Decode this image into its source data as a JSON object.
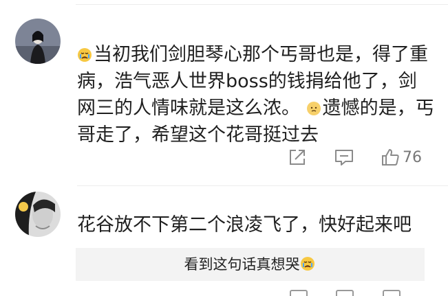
{
  "comments": [
    {
      "avatar_icon": "avatar-girl-photo",
      "text_part1": "当初我们剑胆琴心那个丐哥也是，得了重病，浩气恶人世界boss的钱捐给他了，剑网三的人情味就是这么浓。",
      "text_part2": "遗憾的是，丐哥走了，希望这个花哥挺过去",
      "emoji1": "crying-face-emoji",
      "emoji2": "sad-face-emoji",
      "actions": {
        "share_icon": "share-icon",
        "reply_icon": "comment-icon",
        "like_icon": "thumbs-up-icon",
        "like_count": "76"
      }
    },
    {
      "avatar_icon": "avatar-face-photo",
      "text": "花谷放不下第二个浪凌飞了，快好起来吧",
      "reply": {
        "text": "看到这句话真想哭",
        "emoji": "crying-face-emoji"
      }
    }
  ],
  "colors": {
    "text": "#1f1f1f",
    "icon": "#8a8a8a",
    "reply_bg": "#f3f3f3",
    "emoji_yellow": "#f7c842"
  }
}
